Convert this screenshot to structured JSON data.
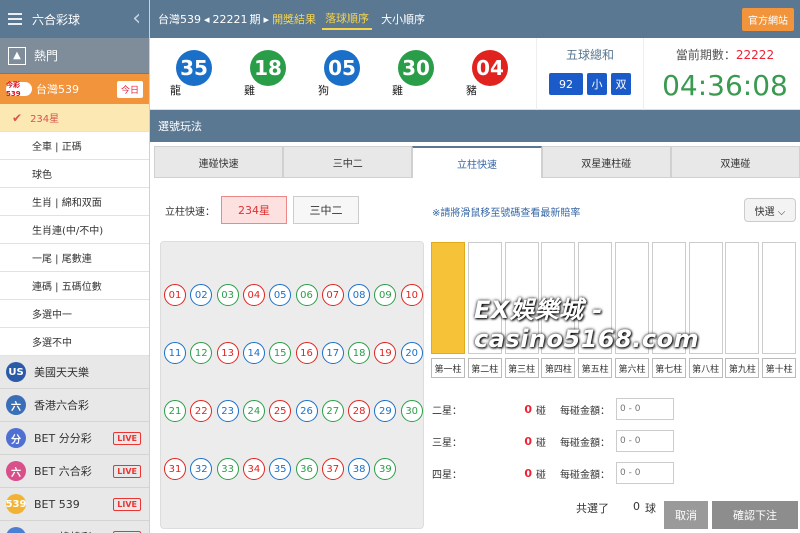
{
  "sidebar": {
    "title": "六合彩球",
    "category": "熱門",
    "active_game": {
      "name": "台灣539",
      "badge": "今日",
      "logo_text": "今彩539"
    },
    "subitems": [
      "234星",
      "全車 | 正碼",
      "球色",
      "生肖 | 綿和双面",
      "生肖連(中/不中)",
      "一尾 | 尾數連",
      "連碼 | 五碼位數",
      "多選中一",
      "多選不中"
    ],
    "other_games": [
      {
        "name": "美國天天樂",
        "icon_text": "US",
        "color": "#2a5aa8"
      },
      {
        "name": "香港六合彩",
        "icon_text": "六",
        "color": "#3a6fb8"
      },
      {
        "name": "BET 分分彩",
        "icon_text": "分",
        "color": "#4f6fd3",
        "live": "LIVE"
      },
      {
        "name": "BET 六合彩",
        "icon_text": "六",
        "color": "#d84f8a",
        "live": "LIVE"
      },
      {
        "name": "BET 539",
        "icon_text": "539",
        "color": "#f2b233",
        "live": "LIVE"
      },
      {
        "name": "BET 韓韓彩",
        "icon_text": "韓",
        "color": "#4a7fd3",
        "live": "LIVE"
      }
    ]
  },
  "topbar": {
    "game": "台灣539",
    "period": "22221",
    "period_unit": "期",
    "results": "開獎結果",
    "tab_active": "落球順序",
    "tab_other": "大小順序",
    "official": "官方網站"
  },
  "draw": {
    "balls": [
      {
        "n": "35",
        "zodiac": "龍",
        "color": "#1a6fc9"
      },
      {
        "n": "18",
        "zodiac": "雞",
        "color": "#2a9d48"
      },
      {
        "n": "05",
        "zodiac": "狗",
        "color": "#1a6fc9"
      },
      {
        "n": "30",
        "zodiac": "雞",
        "color": "#2a9d48"
      },
      {
        "n": "04",
        "zodiac": "豬",
        "color": "#e0231f"
      }
    ],
    "sum_title": "五球總和",
    "sum_value": "92",
    "sum_size": "小",
    "sum_parity": "双",
    "period_label": "當前期數：",
    "period_value": "22222",
    "countdown": "04:36:08"
  },
  "section_title": "選號玩法",
  "tabs": [
    "連碰快速",
    "三中二",
    "立柱快速",
    "双星連柱碰",
    "双連碰"
  ],
  "active_tab": 2,
  "quick": {
    "label": "立柱快速：",
    "opt1": "234星",
    "opt2": "三中二"
  },
  "hint": "※請將滑鼠移至號碼查看最新賠率",
  "fast_select": "快選 ⌵",
  "numbers": [
    {
      "n": "01",
      "c": "#e0231f"
    },
    {
      "n": "02",
      "c": "#1a6fc9"
    },
    {
      "n": "03",
      "c": "#2a9d48"
    },
    {
      "n": "04",
      "c": "#e0231f"
    },
    {
      "n": "05",
      "c": "#1a6fc9"
    },
    {
      "n": "06",
      "c": "#2a9d48"
    },
    {
      "n": "07",
      "c": "#e0231f"
    },
    {
      "n": "08",
      "c": "#1a6fc9"
    },
    {
      "n": "09",
      "c": "#2a9d48"
    },
    {
      "n": "10",
      "c": "#e0231f"
    },
    {
      "n": "11",
      "c": "#1a6fc9"
    },
    {
      "n": "12",
      "c": "#2a9d48"
    },
    {
      "n": "13",
      "c": "#e0231f"
    },
    {
      "n": "14",
      "c": "#1a6fc9"
    },
    {
      "n": "15",
      "c": "#2a9d48"
    },
    {
      "n": "16",
      "c": "#e0231f"
    },
    {
      "n": "17",
      "c": "#1a6fc9"
    },
    {
      "n": "18",
      "c": "#2a9d48"
    },
    {
      "n": "19",
      "c": "#e0231f"
    },
    {
      "n": "20",
      "c": "#1a6fc9"
    },
    {
      "n": "21",
      "c": "#2a9d48"
    },
    {
      "n": "22",
      "c": "#e0231f"
    },
    {
      "n": "23",
      "c": "#1a6fc9"
    },
    {
      "n": "24",
      "c": "#2a9d48"
    },
    {
      "n": "25",
      "c": "#e0231f"
    },
    {
      "n": "26",
      "c": "#1a6fc9"
    },
    {
      "n": "27",
      "c": "#2a9d48"
    },
    {
      "n": "28",
      "c": "#e0231f"
    },
    {
      "n": "29",
      "c": "#1a6fc9"
    },
    {
      "n": "30",
      "c": "#2a9d48"
    },
    {
      "n": "31",
      "c": "#e0231f"
    },
    {
      "n": "32",
      "c": "#1a6fc9"
    },
    {
      "n": "33",
      "c": "#2a9d48"
    },
    {
      "n": "34",
      "c": "#e0231f"
    },
    {
      "n": "35",
      "c": "#1a6fc9"
    },
    {
      "n": "36",
      "c": "#2a9d48"
    },
    {
      "n": "37",
      "c": "#e0231f"
    },
    {
      "n": "38",
      "c": "#1a6fc9"
    },
    {
      "n": "39",
      "c": "#2a9d48"
    }
  ],
  "columns": [
    "第一柱",
    "第二柱",
    "第三柱",
    "第四柱",
    "第五柱",
    "第六柱",
    "第七柱",
    "第八柱",
    "第九柱",
    "第十柱"
  ],
  "active_column": 0,
  "watermark": "EX娛樂城 - casino5168.com",
  "bet_rows": [
    {
      "name": "二星：",
      "count": "0",
      "unit": "碰",
      "amount_label": "每碰金額：",
      "placeholder": "0 - 0"
    },
    {
      "name": "三星：",
      "count": "0",
      "unit": "碰",
      "amount_label": "每碰金額：",
      "placeholder": "0 - 0"
    },
    {
      "name": "四星：",
      "count": "0",
      "unit": "碰",
      "amount_label": "每碰金額：",
      "placeholder": "0 - 0"
    }
  ],
  "footer": {
    "selected_label": "共選了",
    "selected_count": "0",
    "selected_unit": "球",
    "cancel": "取消",
    "confirm": "確認下注"
  }
}
